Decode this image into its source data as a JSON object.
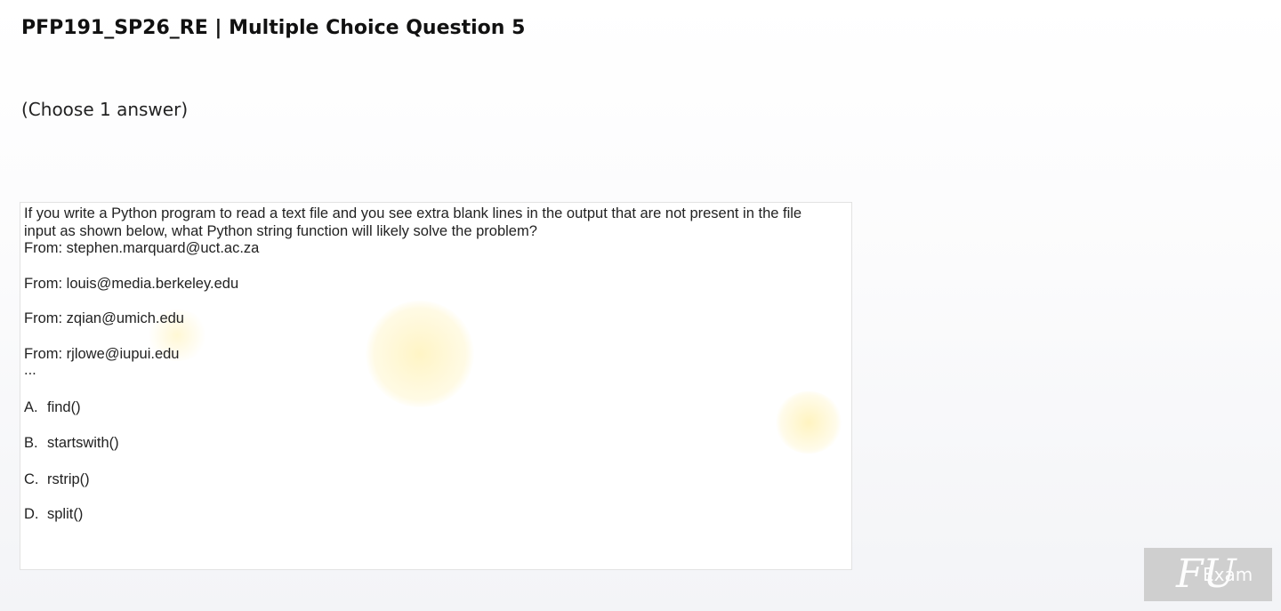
{
  "header": {
    "title": "PFP191_SP26_RE | Multiple Choice Question 5",
    "instruction": "(Choose 1 answer)"
  },
  "question": {
    "text": "If you write a Python program to read a text file and you see extra blank lines in the output that are not present in the file input as shown below, what Python string function will likely solve the problem?",
    "sample_lines": [
      "From: stephen.marquard@uct.ac.za",
      "From: louis@media.berkeley.edu",
      "From: zqian@umich.edu",
      "From: rjlowe@iupui.edu",
      "..."
    ]
  },
  "options": [
    {
      "letter": "A.",
      "text": "find()"
    },
    {
      "letter": "B.",
      "text": "startswith()"
    },
    {
      "letter": "C.",
      "text": "rstrip()"
    },
    {
      "letter": "D.",
      "text": "split()"
    }
  ],
  "logo": {
    "mark": "FU",
    "word": "Exam"
  }
}
